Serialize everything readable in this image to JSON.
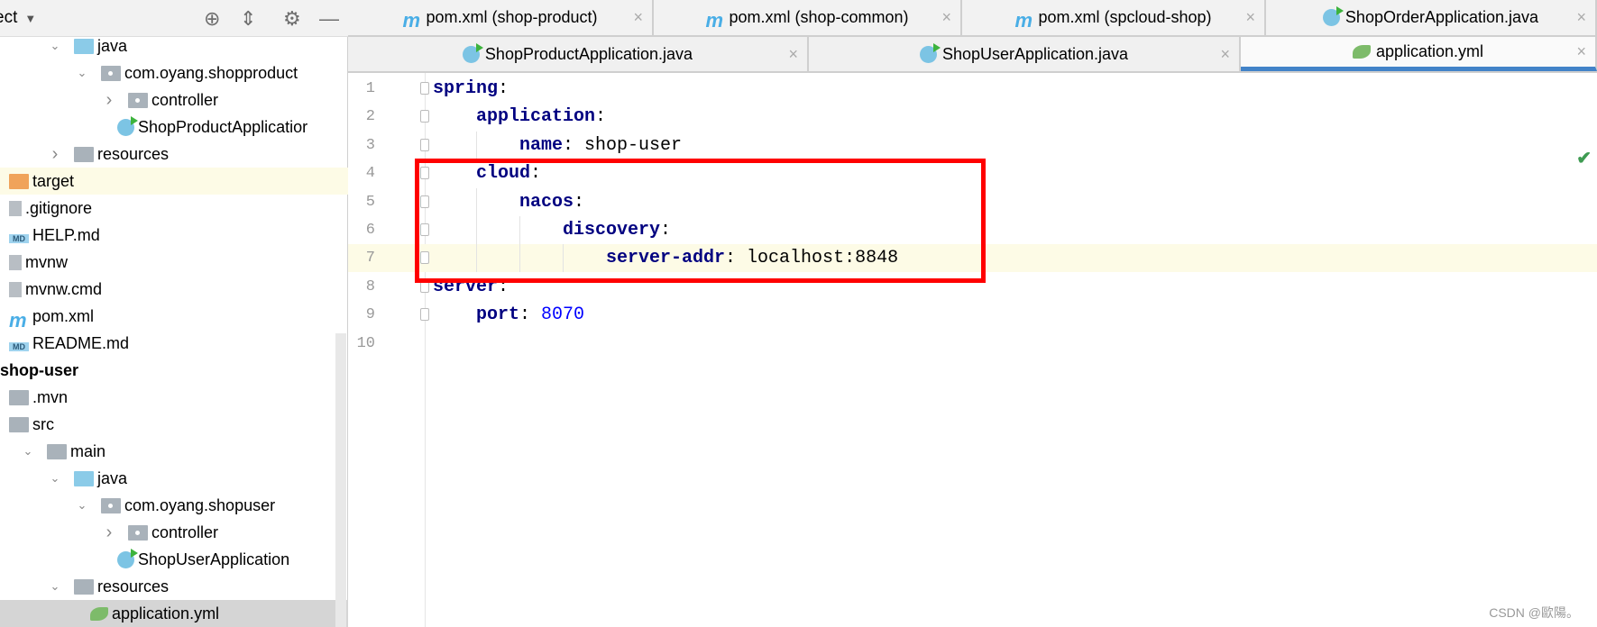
{
  "sidebar": {
    "title": "ect",
    "tree": [
      {
        "label": "java",
        "depth": 2,
        "arrow": "open",
        "icon": "folder-blue"
      },
      {
        "label": "com.oyang.shopproduct",
        "depth": 3,
        "arrow": "open",
        "icon": "package"
      },
      {
        "label": "controller",
        "depth": 4,
        "arrow": "closed",
        "icon": "package"
      },
      {
        "label": "ShopProductApplicatior",
        "depth": 4,
        "arrow": "",
        "icon": "spring-class"
      },
      {
        "label": "resources",
        "depth": 2,
        "arrow": "closed",
        "icon": "resources-folder"
      },
      {
        "label": "target",
        "depth": 0,
        "arrow": "",
        "icon": "folder-orange",
        "state": "hl"
      },
      {
        "label": ".gitignore",
        "depth": 0,
        "arrow": "",
        "icon": "file"
      },
      {
        "label": "HELP.md",
        "depth": 0,
        "arrow": "",
        "icon": "md"
      },
      {
        "label": "mvnw",
        "depth": 0,
        "arrow": "",
        "icon": "file"
      },
      {
        "label": "mvnw.cmd",
        "depth": 0,
        "arrow": "",
        "icon": "file"
      },
      {
        "label": "pom.xml",
        "depth": 0,
        "arrow": "",
        "icon": "maven"
      },
      {
        "label": "README.md",
        "depth": 0,
        "arrow": "",
        "icon": "md"
      },
      {
        "label": "shop-user",
        "depth": -1,
        "arrow": "",
        "icon": "",
        "bold": true
      },
      {
        "label": ".mvn",
        "depth": 0,
        "arrow": "",
        "icon": "folder"
      },
      {
        "label": "src",
        "depth": 0,
        "arrow": "",
        "icon": "folder"
      },
      {
        "label": "main",
        "depth": 1,
        "arrow": "open",
        "icon": "folder"
      },
      {
        "label": "java",
        "depth": 2,
        "arrow": "open",
        "icon": "folder-blue"
      },
      {
        "label": "com.oyang.shopuser",
        "depth": 3,
        "arrow": "open",
        "icon": "package"
      },
      {
        "label": "controller",
        "depth": 4,
        "arrow": "closed",
        "icon": "package"
      },
      {
        "label": "ShopUserApplication",
        "depth": 4,
        "arrow": "",
        "icon": "spring-class"
      },
      {
        "label": "resources",
        "depth": 2,
        "arrow": "open",
        "icon": "resources-folder"
      },
      {
        "label": "application.yml",
        "depth": 3,
        "arrow": "",
        "icon": "spring-yml",
        "state": "sel"
      }
    ]
  },
  "tabs_row1": [
    {
      "label": "pom.xml (shop-product)",
      "icon": "maven"
    },
    {
      "label": "pom.xml (shop-common)",
      "icon": "maven"
    },
    {
      "label": "pom.xml (spcloud-shop)",
      "icon": "maven"
    },
    {
      "label": "ShopOrderApplication.java",
      "icon": "spring-class"
    }
  ],
  "tabs_row2": [
    {
      "label": "ShopProductApplication.java",
      "icon": "spring-class"
    },
    {
      "label": "ShopUserApplication.java",
      "icon": "spring-class"
    },
    {
      "label": "application.yml",
      "icon": "spring-yml",
      "active": true
    }
  ],
  "editor": {
    "lines": [
      {
        "n": "1",
        "indent": 0,
        "key": "spring",
        "value": ""
      },
      {
        "n": "2",
        "indent": 1,
        "key": "application",
        "value": ""
      },
      {
        "n": "3",
        "indent": 2,
        "key": "name",
        "value": "shop-user"
      },
      {
        "n": "4",
        "indent": 1,
        "key": "cloud",
        "value": ""
      },
      {
        "n": "5",
        "indent": 2,
        "key": "nacos",
        "value": ""
      },
      {
        "n": "6",
        "indent": 3,
        "key": "discovery",
        "value": ""
      },
      {
        "n": "7",
        "indent": 4,
        "key": "server-addr",
        "value": "localhost:8848",
        "current": true
      },
      {
        "n": "8",
        "indent": 0,
        "key": "server",
        "value": ""
      },
      {
        "n": "9",
        "indent": 1,
        "key": "port",
        "value": "8070",
        "numeric": true
      },
      {
        "n": "10",
        "indent": 0,
        "key": "",
        "value": ""
      }
    ]
  },
  "watermark": "CSDN @歐陽。",
  "colors": {
    "key": "#000080",
    "number": "#0000ff",
    "highlight": "#ff0000",
    "active_tab": "#4283c8"
  }
}
